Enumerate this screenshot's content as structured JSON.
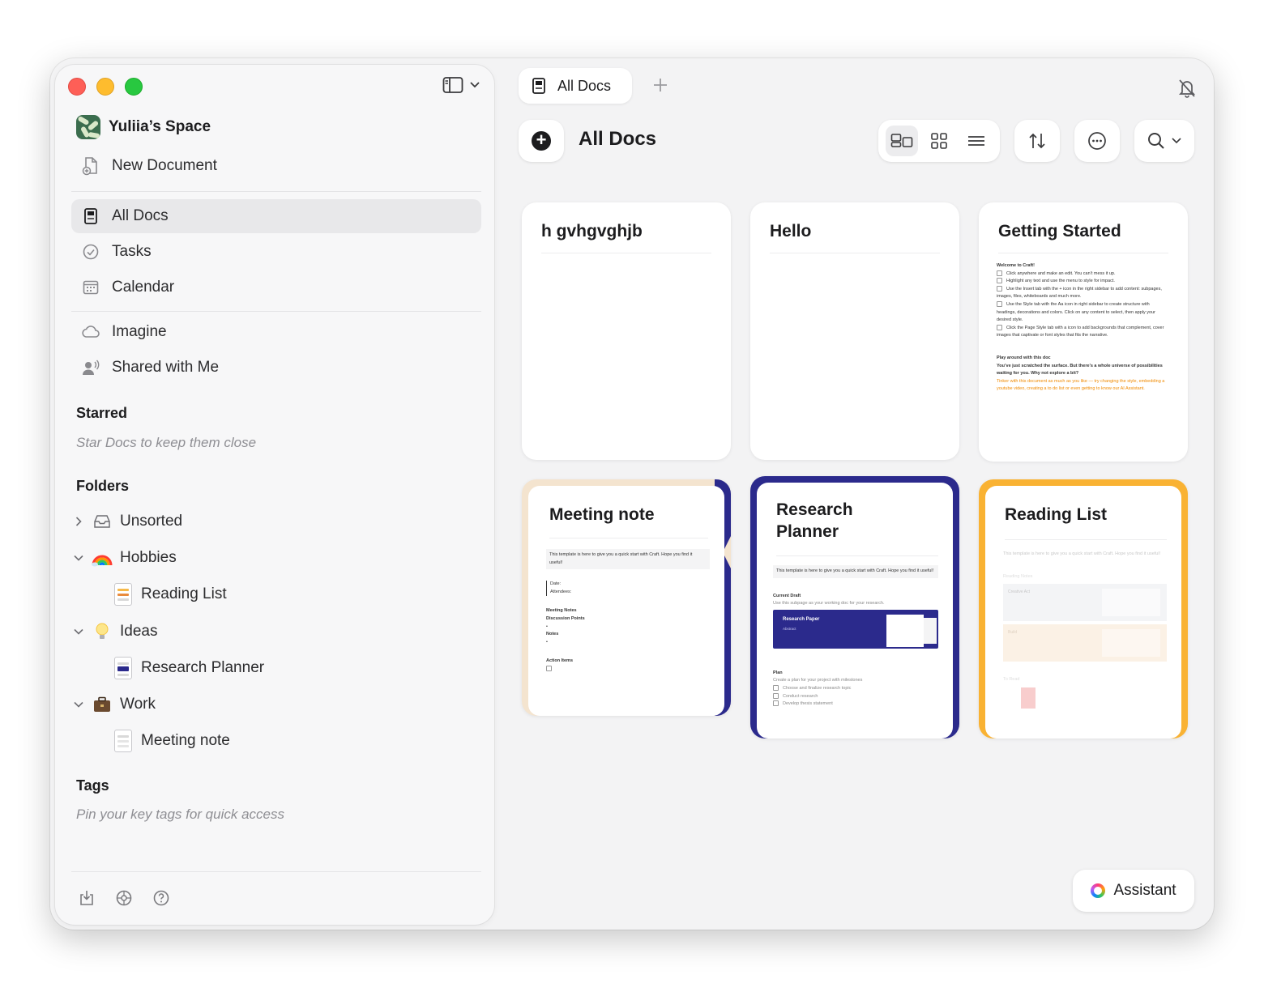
{
  "tab": {
    "label": "All Docs"
  },
  "sidebar": {
    "space_name": "Yuliia’s Space",
    "new_document": "New Document",
    "nav": [
      {
        "label": "All Docs",
        "icon": "doc-stack-icon",
        "active": true
      },
      {
        "label": "Tasks",
        "icon": "checkmark-circle-icon"
      },
      {
        "label": "Calendar",
        "icon": "calendar-icon"
      }
    ],
    "nav2": [
      {
        "label": "Imagine",
        "icon": "cloud-icon"
      },
      {
        "label": "Shared with Me",
        "icon": "shared-person-icon"
      }
    ],
    "starred_heading": "Starred",
    "starred_hint": "Star Docs to keep them close",
    "folders_heading": "Folders",
    "folders": [
      {
        "label": "Unsorted",
        "icon": "inbox-icon",
        "expanded": false
      },
      {
        "label": "Hobbies",
        "icon": "rainbow-icon",
        "expanded": true,
        "children": [
          "Reading List"
        ]
      },
      {
        "label": "Ideas",
        "icon": "lightbulb-icon",
        "expanded": true,
        "children": [
          "Research Planner"
        ]
      },
      {
        "label": "Work",
        "icon": "briefcase-icon",
        "expanded": true,
        "children": [
          "Meeting note"
        ]
      }
    ],
    "tags_heading": "Tags",
    "tags_hint": "Pin your key tags for quick access"
  },
  "main": {
    "title": "All Docs",
    "assistant_label": "Assistant"
  },
  "cards": [
    {
      "title": "h gvhgvghjb"
    },
    {
      "title": "Hello"
    },
    {
      "title": "Getting Started",
      "body": {
        "h1": "Welcome to Craft!",
        "items": [
          "Click anywhere and make an edit. You can’t mess it up.",
          "Highlight any text and use the menu to style for impact.",
          "Use the Insert tab with the + icon in the right sidebar to add content: subpages, images, files, whiteboards and much more.",
          "Use the Style tab with the Aa icon in right sidebar to create structure with headings, decorations and colors. Click on any content to select, then apply your desired style.",
          "Click the Page Style tab with a icon to add backgrounds that complement, cover images that captivate or font styles that fits the narrative."
        ],
        "h2": "Play around with this doc",
        "p1": "You’ve just scratched the surface. But there’s a whole universe of possibilities waiting for you. Why not explore a bit?",
        "p2": "Tinker with this document as much as you like — try changing the style, embedding a youtube video, creating a to do list or even getting to know our AI Assistant."
      }
    },
    {
      "title": "Meeting note",
      "body": {
        "intro": "This template is here to give you a quick start with Craft. Hope you find it useful!",
        "date": "Date:",
        "attendees": "Attendees:",
        "notes_h": "Meeting Notes",
        "discussion": "Discussion Points",
        "notes": "Notes",
        "action": "Action Items"
      }
    },
    {
      "title": "Research Planner",
      "body": {
        "intro": "This template is here to give you a quick start with Craft. Hope you find it useful!",
        "draft_h": "Current Draft",
        "draft_p": "Use this subpage as your working doc for your research.",
        "paper_title": "Research Paper",
        "paper_sub": "Abstract",
        "plan_h": "Plan",
        "plan_p": "Create a plan for your project with milestones",
        "plan_items": [
          "Choose and finalize research topic",
          "Conduct research",
          "Develop thesis statement"
        ]
      }
    },
    {
      "title": "Reading List",
      "body": {
        "intro": "This template is here to give you a quick start with Craft. Hope you find it useful!",
        "notes_h": "Reading Notes",
        "book1": "Creative Act",
        "book2": "Build",
        "to_read": "To Read"
      }
    }
  ],
  "colors": {
    "research_accent": "#2b2a8c",
    "reading_accent": "#f9b233",
    "meeting_accent": "#2b2a8c",
    "meeting_beige": "#f4e4cf"
  }
}
